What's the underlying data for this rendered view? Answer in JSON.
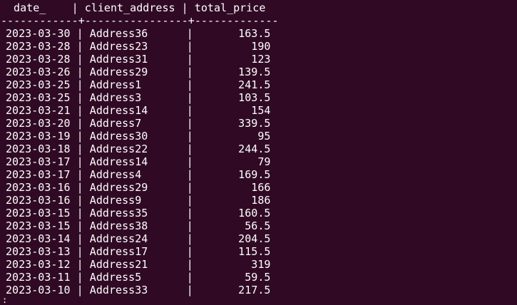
{
  "table": {
    "header": " date_    | client_address | total_price",
    "separator": "------------+----------------+-------------",
    "rows": [
      "2023-03-30 | Address36      |       163.5",
      "2023-03-28 | Address23      |         190",
      "2023-03-28 | Address31      |         123",
      "2023-03-26 | Address29      |       139.5",
      "2023-03-25 | Address1       |       241.5",
      "2023-03-25 | Address3       |       103.5",
      "2023-03-21 | Address14      |         154",
      "2023-03-20 | Address7       |       339.5",
      "2023-03-19 | Address30      |          95",
      "2023-03-18 | Address22      |       244.5",
      "2023-03-17 | Address14      |          79",
      "2023-03-17 | Address4       |       169.5",
      "2023-03-16 | Address29      |         166",
      "2023-03-16 | Address9       |         186",
      "2023-03-15 | Address35      |       160.5",
      "2023-03-15 | Address38      |        56.5",
      "2023-03-14 | Address24      |       204.5",
      "2023-03-13 | Address17      |       115.5",
      "2023-03-12 | Address21      |         319",
      "2023-03-11 | Address5       |        59.5",
      "2023-03-10 | Address33      |       217.5"
    ]
  },
  "prompt_char": ":"
}
